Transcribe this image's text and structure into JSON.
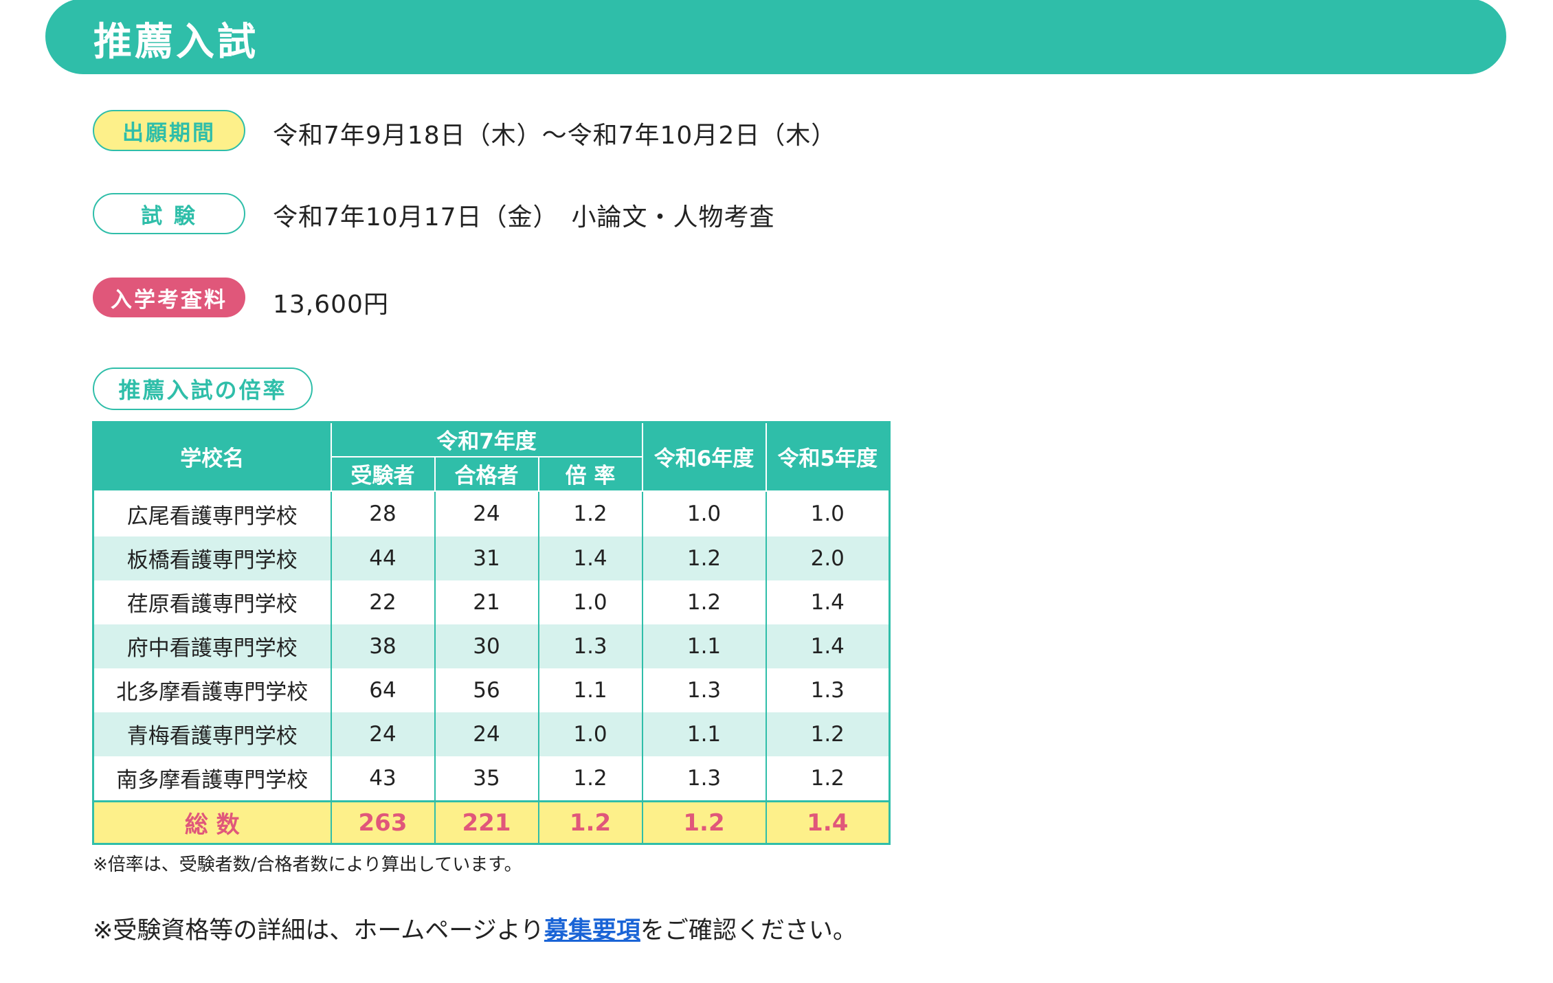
{
  "header": {
    "title": "推薦入試"
  },
  "application_period": {
    "label": "出願期間",
    "value": "令和7年9月18日（木）〜令和7年10月2日（木）"
  },
  "exam": {
    "label": "試 験",
    "value": "令和7年10月17日（金）　小論文・人物考査"
  },
  "fee": {
    "label": "入学考査料",
    "value": "13,600円"
  },
  "rate_section": {
    "label": "推薦入試の倍率"
  },
  "table": {
    "headers": {
      "school": "学校名",
      "r7": "令和7年度",
      "examinees": "受験者",
      "passed": "合格者",
      "ratio": "倍 率",
      "r6": "令和6年度",
      "r5": "令和5年度"
    },
    "rows": [
      {
        "school": "広尾看護専門学校",
        "examinees": "28",
        "passed": "24",
        "ratio": "1.2",
        "r6": "1.0",
        "r5": "1.0"
      },
      {
        "school": "板橋看護専門学校",
        "examinees": "44",
        "passed": "31",
        "ratio": "1.4",
        "r6": "1.2",
        "r5": "2.0"
      },
      {
        "school": "荏原看護専門学校",
        "examinees": "22",
        "passed": "21",
        "ratio": "1.0",
        "r6": "1.2",
        "r5": "1.4"
      },
      {
        "school": "府中看護専門学校",
        "examinees": "38",
        "passed": "30",
        "ratio": "1.3",
        "r6": "1.1",
        "r5": "1.4"
      },
      {
        "school": "北多摩看護専門学校",
        "examinees": "64",
        "passed": "56",
        "ratio": "1.1",
        "r6": "1.3",
        "r5": "1.3"
      },
      {
        "school": "青梅看護専門学校",
        "examinees": "24",
        "passed": "24",
        "ratio": "1.0",
        "r6": "1.1",
        "r5": "1.2"
      },
      {
        "school": "南多摩看護専門学校",
        "examinees": "43",
        "passed": "35",
        "ratio": "1.2",
        "r6": "1.3",
        "r5": "1.2"
      }
    ],
    "total": {
      "school": "総 数",
      "examinees": "263",
      "passed": "221",
      "ratio": "1.2",
      "r6": "1.2",
      "r5": "1.4"
    }
  },
  "notes": {
    "ratio_note": "※倍率は、受験者数/合格者数により算出しています。",
    "detail_prefix": "※受験資格等の詳細は、ホームページより",
    "detail_link": "募集要項",
    "detail_suffix": "をご確認ください。"
  },
  "colors": {
    "teal": "#2fbea9",
    "yellow": "#fdf08a",
    "pink": "#e0577a",
    "row_alt": "#d6f2ed",
    "link": "#1a64d6"
  }
}
